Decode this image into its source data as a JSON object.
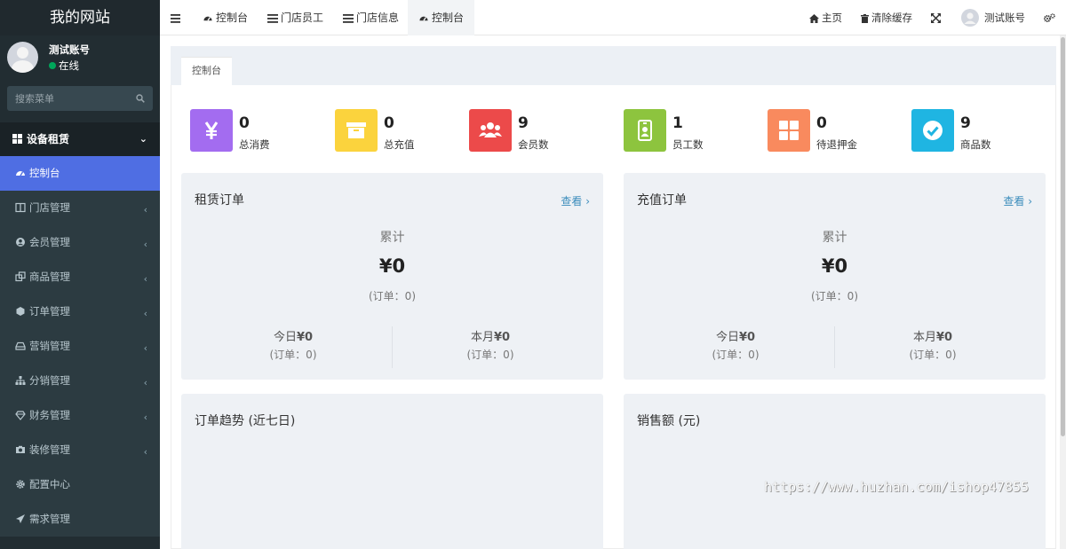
{
  "sidebar": {
    "logo": "我的网站",
    "user": {
      "name": "测试账号",
      "status": "在线"
    },
    "search": {
      "placeholder": "搜索菜单"
    },
    "header": {
      "label": "设备租赁"
    },
    "items": [
      {
        "label": "控制台",
        "icon": "dashboard-icon",
        "active": true
      },
      {
        "label": "门店管理",
        "icon": "columns-icon"
      },
      {
        "label": "会员管理",
        "icon": "user-circle-icon"
      },
      {
        "label": "商品管理",
        "icon": "clone-icon"
      },
      {
        "label": "订单管理",
        "icon": "hexagon-icon"
      },
      {
        "label": "营销管理",
        "icon": "hdd-icon"
      },
      {
        "label": "分销管理",
        "icon": "sitemap-icon"
      },
      {
        "label": "财务管理",
        "icon": "diamond-icon"
      },
      {
        "label": "装修管理",
        "icon": "camera-icon"
      },
      {
        "label": "配置中心",
        "icon": "gear-icon"
      },
      {
        "label": "需求管理",
        "icon": "paper-plane-icon"
      }
    ]
  },
  "topbar": {
    "tabs": [
      {
        "label": "控制台",
        "icon": "dashboard-icon"
      },
      {
        "label": "门店员工",
        "icon": "list-icon"
      },
      {
        "label": "门店信息",
        "icon": "list-icon"
      },
      {
        "label": "控制台",
        "icon": "dashboard-icon",
        "active": true
      }
    ],
    "home": "主页",
    "clear_cache": "清除缓存",
    "user": "测试账号"
  },
  "panel_tab": "控制台",
  "stats": [
    {
      "value": "0",
      "label": "总消费",
      "color": "#a36cf0",
      "icon": "yen-icon"
    },
    {
      "value": "0",
      "label": "总充值",
      "color": "#fbd33d",
      "icon": "archive-icon"
    },
    {
      "value": "9",
      "label": "会员数",
      "color": "#ec4a4a",
      "icon": "users-icon"
    },
    {
      "value": "1",
      "label": "员工数",
      "color": "#8dc43e",
      "icon": "id-badge-icon"
    },
    {
      "value": "0",
      "label": "待退押金",
      "color": "#f98a5e",
      "icon": "th-large-icon"
    },
    {
      "value": "9",
      "label": "商品数",
      "color": "#1fb5e2",
      "icon": "check-circle-icon"
    }
  ],
  "rent_card": {
    "title": "租赁订单",
    "more": "查看",
    "total_label": "累计",
    "total_amount": "¥0",
    "total_count": "(订单：0)",
    "today_label": "今日",
    "today_amount": "¥0",
    "today_count": "(订单：0)",
    "month_label": "本月",
    "month_amount": "¥0",
    "month_count": "(订单：0)"
  },
  "recharge_card": {
    "title": "充值订单",
    "more": "查看",
    "total_label": "累计",
    "total_amount": "¥0",
    "total_count": "(订单：0)",
    "today_label": "今日",
    "today_amount": "¥0",
    "today_count": "(订单：0)",
    "month_label": "本月",
    "month_amount": "¥0",
    "month_count": "(订单：0)"
  },
  "trend_card": {
    "title": "订单趋势 (近七日)"
  },
  "sales_card": {
    "title": "销售额 (元)"
  },
  "watermark": "https://www.huzhan.com/ishop47855"
}
